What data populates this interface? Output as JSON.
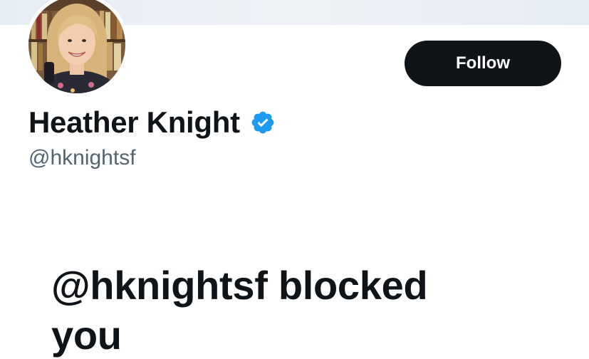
{
  "profile": {
    "display_name": "Heather Knight",
    "handle": "@hknightsf",
    "verified": true,
    "avatar": "profile-photo"
  },
  "actions": {
    "follow_label": "Follow"
  },
  "notice": {
    "blocked_message": "@hknightsf blocked you"
  },
  "colors": {
    "button_bg": "#0f1419",
    "verified_badge": "#1d9bf0",
    "secondary_text": "#536471"
  }
}
